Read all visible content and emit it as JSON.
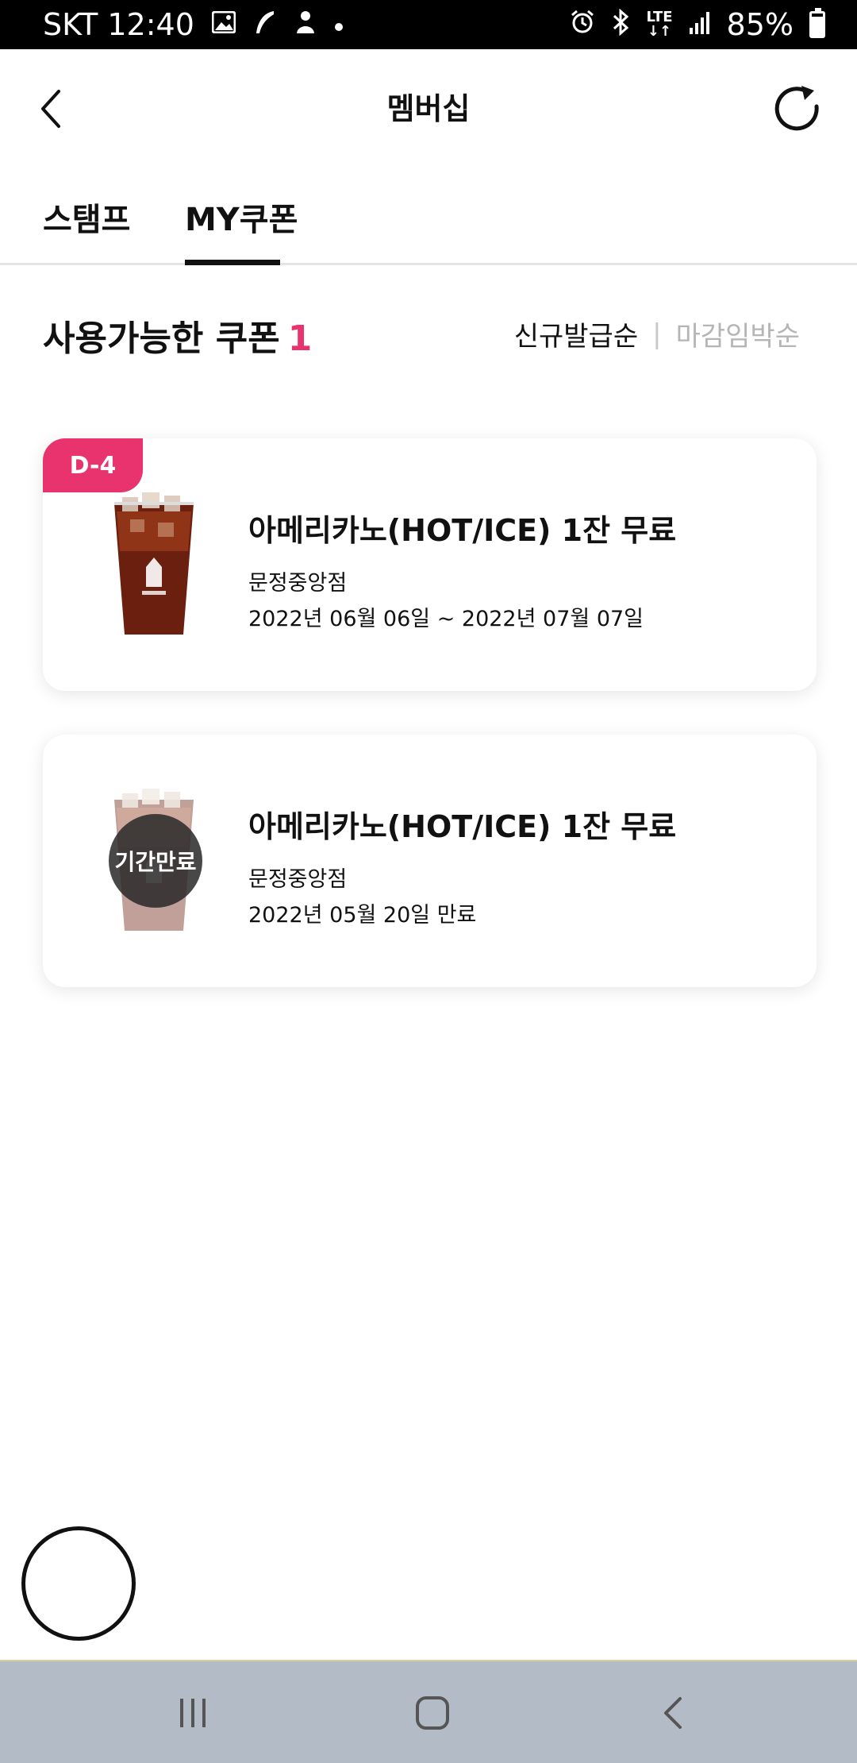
{
  "status_bar": {
    "carrier_time": "SKT 12:40",
    "battery": "85%",
    "network": "LTE",
    "battery_fraction": 0.85,
    "icons": [
      "image-icon",
      "feather-icon",
      "person-icon",
      "dot-icon",
      "alarm-icon",
      "bluetooth-icon",
      "lte-icon",
      "signal-icon",
      "battery-icon"
    ]
  },
  "header": {
    "title": "멤버십",
    "back_icon": "chevron-left-icon",
    "refresh_icon": "refresh-icon"
  },
  "tabs": [
    {
      "label": "스탬프",
      "active": false
    },
    {
      "label": "MY쿠폰",
      "active": true
    }
  ],
  "section": {
    "title": "사용가능한 쿠폰",
    "count": "1"
  },
  "sort": {
    "newest": "신규발급순",
    "separator": "|",
    "deadline": "마감임박순"
  },
  "coupons": [
    {
      "badge": "D-4",
      "title": "아메리카노(HOT/ICE) 1잔 무료",
      "store": "문정중앙점",
      "period": "2022년 06월 06일 ~ 2022년 07월 07일"
    },
    {
      "overlay": "기간만료",
      "title": "아메리카노(HOT/ICE) 1잔 무료",
      "store": "문정중앙점",
      "period": "2022년 05월 20일 만료"
    }
  ],
  "nav_bar": {
    "icons": [
      "recent-apps-icon",
      "home-icon",
      "back-icon"
    ]
  },
  "colors": {
    "accent": "#e8336e",
    "nav_bar": "#b3bcc6",
    "status_bar": "#000000"
  }
}
